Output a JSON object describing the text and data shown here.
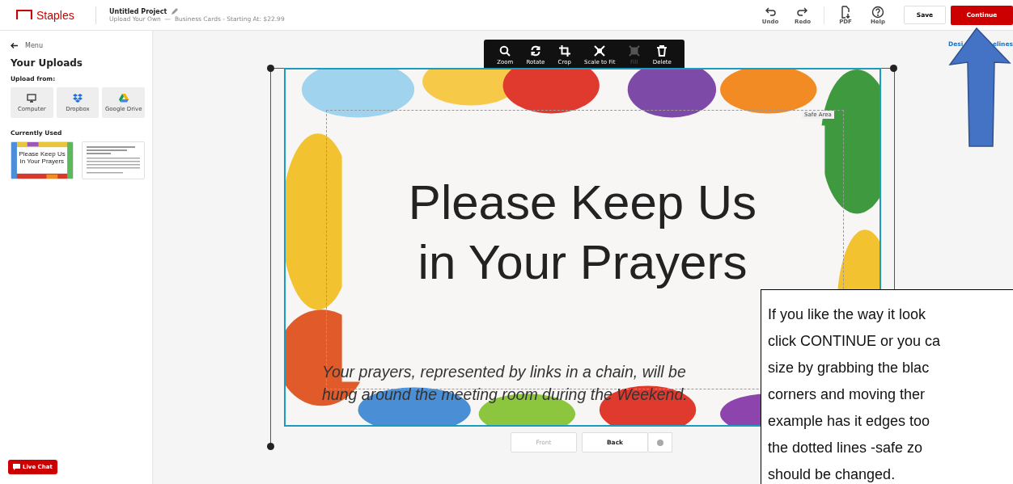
{
  "header": {
    "logo": "Staples",
    "project_title": "Untitled Project",
    "project_subtitle": "Upload Your Own  —  Business Cards - Starting At: $22.99",
    "tools": [
      {
        "kind": "undo",
        "label": "Undo"
      },
      {
        "kind": "redo",
        "label": "Redo"
      },
      {
        "kind": "pdf",
        "label": "PDF"
      },
      {
        "kind": "help",
        "label": "Help"
      }
    ],
    "save": "Save",
    "continue": "Continue"
  },
  "sidebar": {
    "back": "Menu",
    "title": "Your Uploads",
    "upload_from": "Upload from:",
    "sources": [
      {
        "kind": "computer",
        "label": "Computer"
      },
      {
        "kind": "dropbox",
        "label": "Dropbox"
      },
      {
        "kind": "drive",
        "label": "Google Drive"
      }
    ],
    "currently_used": "Currently Used",
    "thumbnails": [
      {
        "kind": "front",
        "headline": "Please Keep Us in Your Prayers"
      },
      {
        "kind": "back"
      }
    ],
    "live_chat": "Live Chat"
  },
  "toolbar": [
    {
      "kind": "zoom",
      "label": "Zoom",
      "disabled": false
    },
    {
      "kind": "rotate",
      "label": "Rotate",
      "disabled": false
    },
    {
      "kind": "crop",
      "label": "Crop",
      "disabled": false
    },
    {
      "kind": "scale",
      "label": "Scale to Fit",
      "disabled": false
    },
    {
      "kind": "fill",
      "label": "Fill",
      "disabled": true
    },
    {
      "kind": "delete",
      "label": "Delete",
      "disabled": false
    }
  ],
  "design_guidelines": {
    "visible_start": "Desi",
    "visible_end": "elines"
  },
  "card": {
    "headline_1": "Please Keep Us",
    "headline_2": "in Your Prayers",
    "body_1": "Your prayers, represented by links in a chain, will be",
    "body_2": "hung around the meeting room during the Weekend.",
    "safe_area": "Safe Area"
  },
  "sides": [
    {
      "label": "Front",
      "selected": false
    },
    {
      "label": "Back",
      "selected": true
    }
  ],
  "callout": {
    "lines": [
      "If you like the way it look",
      "click CONTINUE or you ca",
      "size by grabbing the blac",
      "corners and moving ther",
      "example has it edges too",
      "the dotted lines -safe zo",
      "should be changed."
    ]
  }
}
